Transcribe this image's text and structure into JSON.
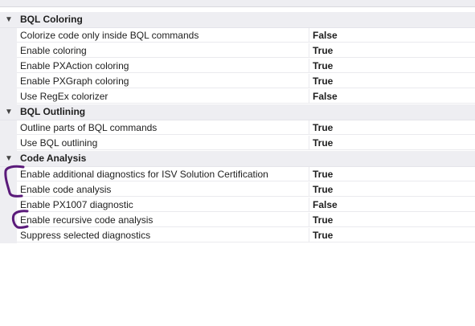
{
  "groups": [
    {
      "label": "BQL Coloring",
      "rows": [
        {
          "name": "Colorize code only inside BQL commands",
          "value": "False"
        },
        {
          "name": "Enable coloring",
          "value": "True"
        },
        {
          "name": "Enable PXAction coloring",
          "value": "True"
        },
        {
          "name": "Enable PXGraph coloring",
          "value": "True"
        },
        {
          "name": "Use RegEx colorizer",
          "value": "False"
        }
      ]
    },
    {
      "label": "BQL Outlining",
      "rows": [
        {
          "name": "Outline parts of BQL commands",
          "value": "True"
        },
        {
          "name": "Use BQL outlining",
          "value": "True"
        }
      ]
    },
    {
      "label": "Code Analysis",
      "rows": [
        {
          "name": "Enable additional diagnostics for ISV Solution Certification",
          "value": "True"
        },
        {
          "name": "Enable code analysis",
          "value": "True"
        },
        {
          "name": "Enable PX1007 diagnostic",
          "value": "False"
        },
        {
          "name": "Enable recursive code analysis",
          "value": "True"
        },
        {
          "name": "Suppress selected diagnostics",
          "value": "True"
        }
      ]
    }
  ],
  "colors": {
    "annotation": "#5a1a7a"
  }
}
